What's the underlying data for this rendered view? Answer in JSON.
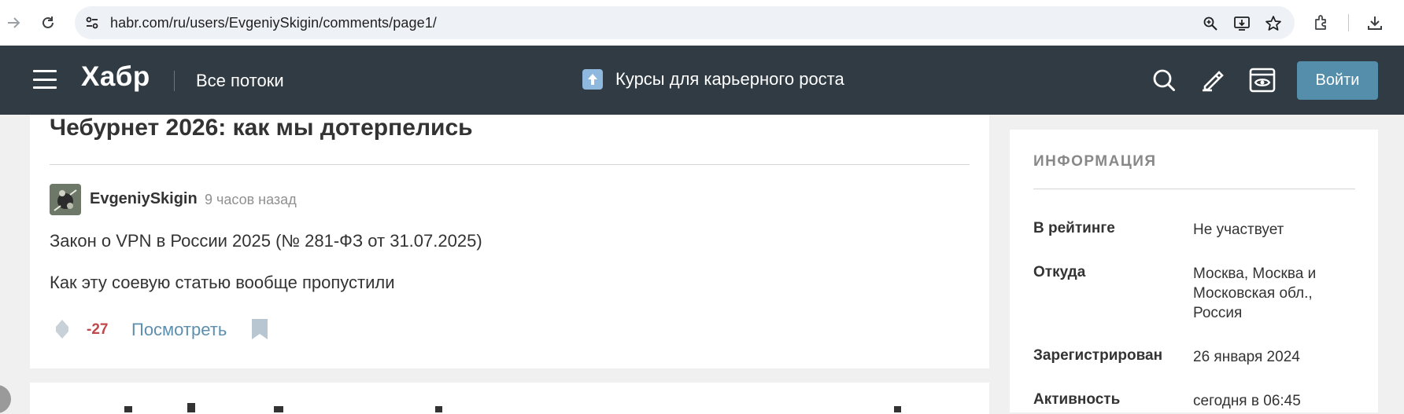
{
  "browser": {
    "url": "habr.com/ru/users/EvgeniySkigin/comments/page1/",
    "icons": [
      "forward-icon",
      "reload-icon",
      "site-settings-icon",
      "zoom-icon",
      "install-app-icon",
      "bookmark-star-icon",
      "extensions-icon",
      "download-icon"
    ]
  },
  "header": {
    "logo": "Хабр",
    "all_streams": "Все потоки",
    "promo_label": "Курсы для карьерного роста",
    "login_label": "Войти",
    "colors": {
      "background": "#303b44",
      "login_button": "#548eaa"
    }
  },
  "comment": {
    "post_title": "Чебурнет 2026: как мы дотерпелись",
    "author": "EvgeniySkigin",
    "time": "9 часов назад",
    "lines": [
      "Закон о VPN в России 2025 (№ 281-ФЗ от 31.07.2025)",
      "Как эту соевую статью вообще пропустили"
    ],
    "score": "-27",
    "view_label": "Посмотреть",
    "colors": {
      "score": "#c0484d",
      "link": "#5d8fae"
    }
  },
  "sidebar": {
    "heading": "ИНФОРМАЦИЯ",
    "rows": [
      {
        "key": "В рейтинге",
        "value": "Не участвует"
      },
      {
        "key": "Откуда",
        "value": "Москва, Москва и Московская обл., Россия"
      },
      {
        "key": "Зарегистрирован",
        "value": "26 января 2024"
      },
      {
        "key": "Активность",
        "value": "сегодня в 06:45"
      }
    ]
  }
}
